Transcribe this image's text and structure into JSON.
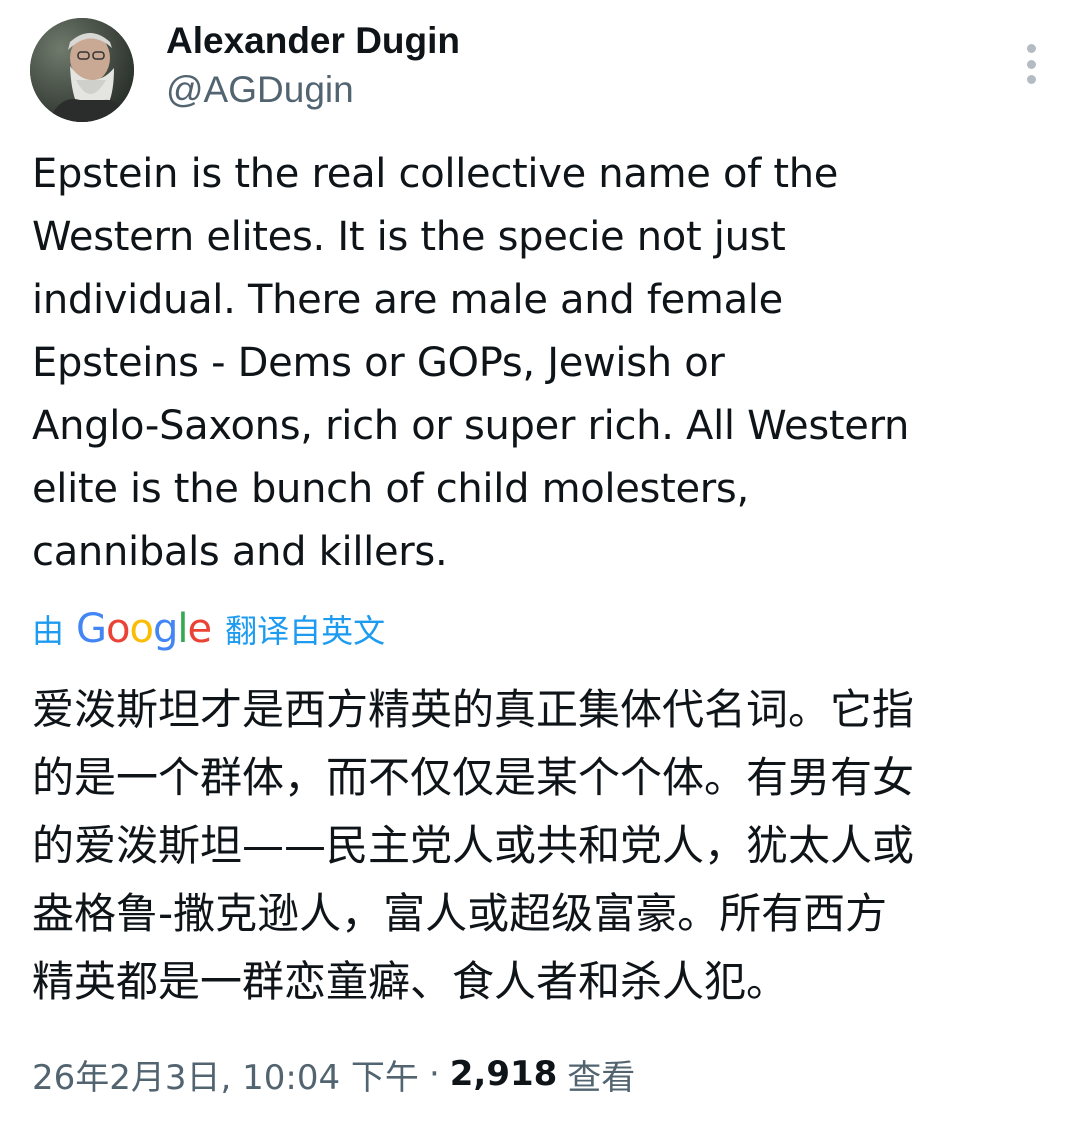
{
  "author": {
    "display_name": "Alexander Dugin",
    "handle": "@AGDugin",
    "avatar_icon": "avatar-photo"
  },
  "tweet": {
    "text": "Epstein is the real collective name of the\nWestern elites. It is the specie not just\nindividual. There are male and female\nEpsteins - Dems or GOPs, Jewish or\nAnglo-Saxons, rich or super rich. All Western\nelite is the bunch of child molesters,\ncannibals and killers."
  },
  "translation": {
    "prefix": "由",
    "provider": "Google",
    "suffix": "翻译自英文",
    "text": "爱泼斯坦才是西方精英的真正集体代名词。它指\n的是一个群体，而不仅仅是某个个体。有男有女\n的爱泼斯坦——民主党人或共和党人，犹太人或\n盎格鲁-撒克逊人，富人或超级富豪。所有西方\n精英都是一群恋童癖、食人者和杀人犯。"
  },
  "meta": {
    "timestamp": "26年2月3日, 10:04 下午",
    "separator": "·",
    "views_count": "2,918",
    "views_label": "查看"
  },
  "colors": {
    "text_primary": "#0f1419",
    "text_secondary": "#536471",
    "link_blue": "#1d9bf0",
    "more_dots": "#b4bcc3"
  },
  "icons": {
    "more": "more-vertical-icon"
  }
}
